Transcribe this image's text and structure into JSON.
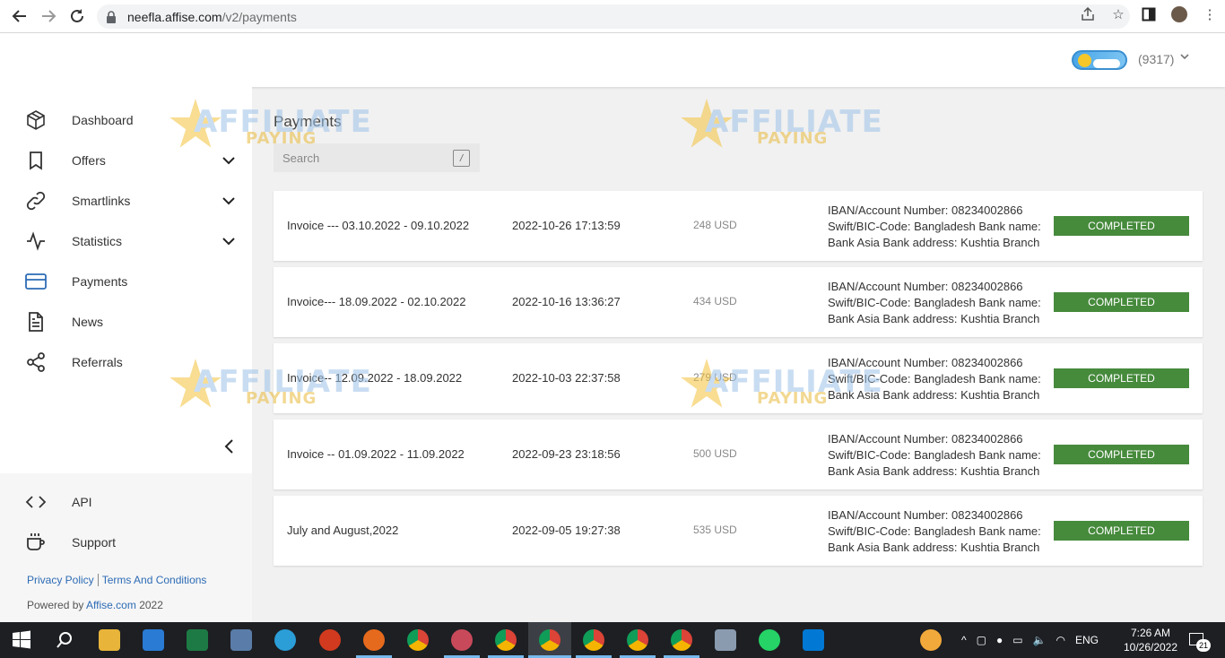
{
  "browser": {
    "url_host": "neefla.affise.com",
    "url_path": "/v2/payments"
  },
  "header": {
    "user_id": "(9317)"
  },
  "sidebar": {
    "items": [
      {
        "label": "Dashboard",
        "icon": "cube-icon",
        "has_submenu": false
      },
      {
        "label": "Offers",
        "icon": "bookmark-icon",
        "has_submenu": true
      },
      {
        "label": "Smartlinks",
        "icon": "link-icon",
        "has_submenu": true
      },
      {
        "label": "Statistics",
        "icon": "activity-icon",
        "has_submenu": true
      },
      {
        "label": "Payments",
        "icon": "credit-card-icon",
        "has_submenu": false,
        "active": true
      },
      {
        "label": "News",
        "icon": "document-icon",
        "has_submenu": false
      },
      {
        "label": "Referrals",
        "icon": "share-icon",
        "has_submenu": false
      }
    ],
    "bottom_items": [
      {
        "label": "API",
        "icon": "code-icon"
      },
      {
        "label": "Support",
        "icon": "coffee-cup-icon"
      }
    ],
    "privacy_link": "Privacy Policy",
    "terms_link": "Terms And Conditions",
    "powered_by": "Powered by",
    "powered_brand": "Affise.com",
    "powered_year": "2022"
  },
  "main": {
    "title": "Payments",
    "search_placeholder": "Search",
    "search_shortcut": "/",
    "payments": [
      {
        "name": "Invoice --- 03.10.2022 - 09.10.2022",
        "date": "2022-10-26 17:13:59",
        "amount": "248 USD",
        "details": "IBAN/Account Number: 08234002866 Swift/BIC-Code: Bangladesh Bank name: Bank Asia Bank address: Kushtia Branch",
        "status": "COMPLETED"
      },
      {
        "name": "Invoice--- 18.09.2022 - 02.10.2022",
        "date": "2022-10-16 13:36:27",
        "amount": "434 USD",
        "details": "IBAN/Account Number: 08234002866 Swift/BIC-Code: Bangladesh Bank name: Bank Asia Bank address: Kushtia Branch",
        "status": "COMPLETED"
      },
      {
        "name": "Invoice-- 12.09.2022 - 18.09.2022",
        "date": "2022-10-03 22:37:58",
        "amount": "279 USD",
        "details": "IBAN/Account Number: 08234002866 Swift/BIC-Code: Bangladesh Bank name: Bank Asia Bank address: Kushtia Branch",
        "status": "COMPLETED"
      },
      {
        "name": "Invoice -- 01.09.2022 - 11.09.2022",
        "date": "2022-09-23 23:18:56",
        "amount": "500 USD",
        "details": "IBAN/Account Number: 08234002866 Swift/BIC-Code: Bangladesh Bank name: Bank Asia Bank address: Kushtia Branch",
        "status": "COMPLETED"
      },
      {
        "name": "July and August,2022",
        "date": "2022-09-05 19:27:38",
        "amount": "535 USD",
        "details": "IBAN/Account Number: 08234002866 Swift/BIC-Code: Bangladesh Bank name: Bank Asia Bank address: Kushtia Branch",
        "status": "COMPLETED"
      }
    ]
  },
  "watermark": {
    "line1": "AFFILIATE",
    "line2": "PAYING"
  },
  "taskbar": {
    "language": "ENG",
    "time": "7:26 AM",
    "date": "10/26/2022",
    "notifications": "21"
  },
  "colors": {
    "status_completed": "#468a3c",
    "link": "#2d6bb5",
    "active_nav": "#2d6bb5"
  }
}
